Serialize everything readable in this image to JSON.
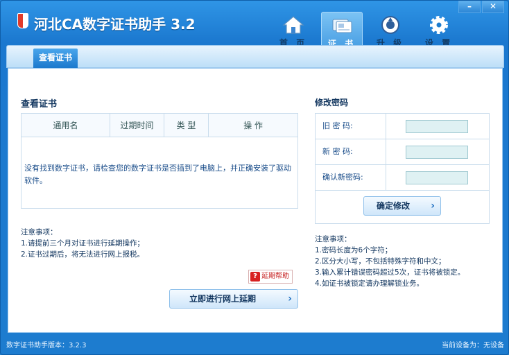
{
  "app": {
    "title": "河北CA数字证书助手 3.2"
  },
  "window_controls": {
    "minimize": "–",
    "close": "✕"
  },
  "nav": [
    {
      "label": "首 页",
      "icon": "home-icon"
    },
    {
      "label": "证 书",
      "icon": "certificate-icon",
      "active": true
    },
    {
      "label": "升 级",
      "icon": "upgrade-icon"
    },
    {
      "label": "设 置",
      "icon": "gear-icon"
    }
  ],
  "subtab": {
    "label": "查看证书"
  },
  "certs": {
    "title": "查看证书",
    "columns": [
      "通用名",
      "过期时间",
      "类 型",
      "操 作"
    ],
    "empty_message": "没有找到数字证书，请检查您的数字证书是否插到了电脑上，并正确安装了驱动软件。",
    "notes": [
      "注意事项：",
      "1.请提前三个月对证书进行延期操作；",
      "2.证书过期后，将无法进行网上报税。"
    ],
    "help_label": "延期帮助",
    "renew_button": "立即进行网上延期"
  },
  "password": {
    "title": "修改密码",
    "fields": [
      {
        "label": "旧  密  码:"
      },
      {
        "label": "新  密  码:"
      },
      {
        "label": "确认新密码:"
      }
    ],
    "confirm_button": "确定修改",
    "notes": [
      "注意事项：",
      "1.密码长度为6个字符；",
      "2.区分大小写，不包括特殊字符和中文；",
      "3.输入累计错误密码超过5次，证书将被锁定。",
      "4.如证书被锁定请办理解锁业务。"
    ]
  },
  "status": {
    "version": "数字证书助手版本：3.2.3",
    "device": "当前设备为：无设备"
  },
  "colors": {
    "accent": "#1d7ccf",
    "title_text": "#12365f",
    "link": "#1a4d8a"
  }
}
